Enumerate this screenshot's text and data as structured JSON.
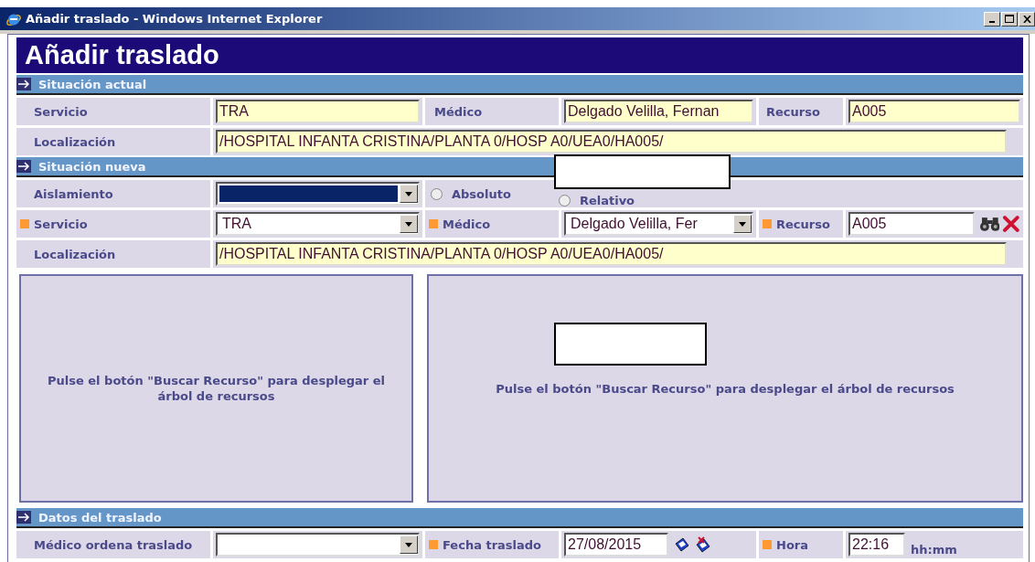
{
  "window": {
    "title": "Añadir traslado - Windows Internet Explorer"
  },
  "page_title": "Añadir traslado",
  "sections": [
    {
      "title": "Situación actual",
      "rows": [
        {
          "cells": [
            {
              "kind": "label",
              "text": "Servicio",
              "required": false
            },
            {
              "kind": "readonly",
              "value": "TRA"
            },
            {
              "kind": "label",
              "text": "Médico",
              "required": false
            },
            {
              "kind": "readonly",
              "value": "Delgado Velilla, Fernan"
            },
            {
              "kind": "label",
              "text": "Recurso",
              "required": false
            },
            {
              "kind": "readonly",
              "value": "A005"
            }
          ]
        },
        {
          "cells": [
            {
              "kind": "label",
              "text": "Localización",
              "required": false
            },
            {
              "kind": "readonly-wide",
              "value": "/HOSPITAL INFANTA CRISTINA/PLANTA 0/HOSP A0/UEA0/HA005/"
            }
          ]
        }
      ]
    },
    {
      "title": "Situación nueva",
      "rows": [
        {
          "cells": [
            {
              "kind": "label",
              "text": "Aislamiento",
              "required": false
            },
            {
              "kind": "select",
              "focused": true
            },
            {
              "kind": "radios",
              "options": [
                {
                  "label": "Absoluto",
                  "selected": false
                },
                {
                  "label": "Relativo",
                  "selected": false
                }
              ]
            }
          ]
        },
        {
          "cells": [
            {
              "kind": "label",
              "text": "Servicio",
              "required": true
            },
            {
              "kind": "select",
              "value": "TRA",
              "focused": false
            },
            {
              "kind": "label",
              "text": "Médico",
              "required": true
            },
            {
              "kind": "select",
              "value": "Delgado Velilla, Fer",
              "focused": false
            },
            {
              "kind": "label",
              "text": "Recurso",
              "required": true
            },
            {
              "kind": "search-input",
              "value": "A005"
            }
          ]
        },
        {
          "cells": [
            {
              "kind": "label",
              "text": "Localización",
              "required": false
            },
            {
              "kind": "readonly-wide",
              "value": "/HOSPITAL INFANTA CRISTINA/PLANTA 0/HOSP A0/UEA0/HA005/"
            }
          ]
        }
      ],
      "panels": [
        "Pulse el botón \"Buscar Recurso\" para desplegar el árbol de recursos",
        "Pulse el botón \"Buscar Recurso\" para desplegar el árbol de recursos"
      ]
    },
    {
      "title": "Datos del traslado",
      "rows": [
        {
          "cells": [
            {
              "kind": "label",
              "text": "Médico ordena traslado",
              "required": false
            },
            {
              "kind": "select",
              "focused": false
            },
            {
              "kind": "label",
              "text": "Fecha traslado",
              "required": true
            },
            {
              "kind": "date-input",
              "value": "27/08/2015"
            },
            {
              "kind": "label",
              "text": "Hora",
              "required": true
            },
            {
              "kind": "time-input",
              "value": "22:16",
              "hint": "hh:mm"
            }
          ]
        }
      ]
    }
  ]
}
